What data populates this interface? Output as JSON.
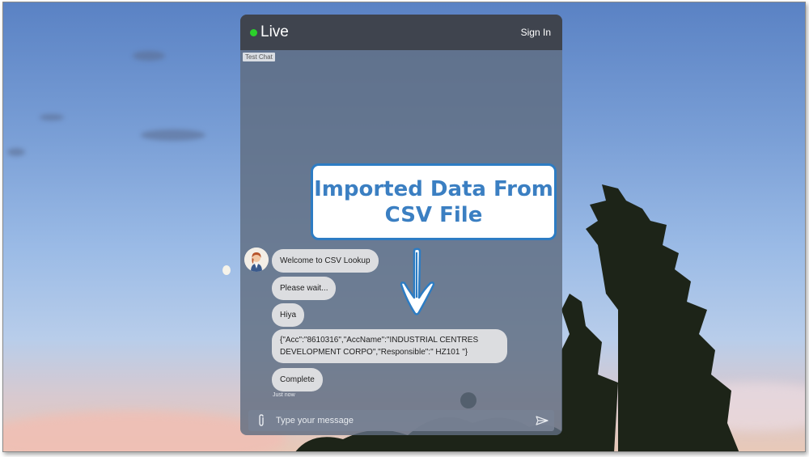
{
  "header": {
    "live_label": "Live",
    "sign_in_label": "Sign In"
  },
  "tag": "Test Chat",
  "messages": [
    {
      "text": "Welcome to CSV Lookup"
    },
    {
      "text": "Please wait..."
    },
    {
      "text": "Hiya"
    },
    {
      "text": "{\"Acc\":\"8610316\",\"AccName\":\"INDUSTRIAL CENTRES DEVELOPMENT CORPO\",\"Responsible\":\" HZ101 \"}"
    },
    {
      "text": "Complete"
    }
  ],
  "timestamp": "Just now",
  "composer": {
    "placeholder": "Type your message"
  },
  "callout": {
    "line1": "Imported Data From",
    "line2": "CSV File"
  },
  "icons": {
    "live_status": "live-status-dot",
    "attach": "paperclip-icon",
    "send": "send-icon",
    "arrow": "down-arrow-icon"
  },
  "colors": {
    "live_dot": "#2bd12b",
    "header_bg": "#3f444e",
    "callout_text": "#3b7fc2",
    "callout_border": "#2d7cc3"
  }
}
